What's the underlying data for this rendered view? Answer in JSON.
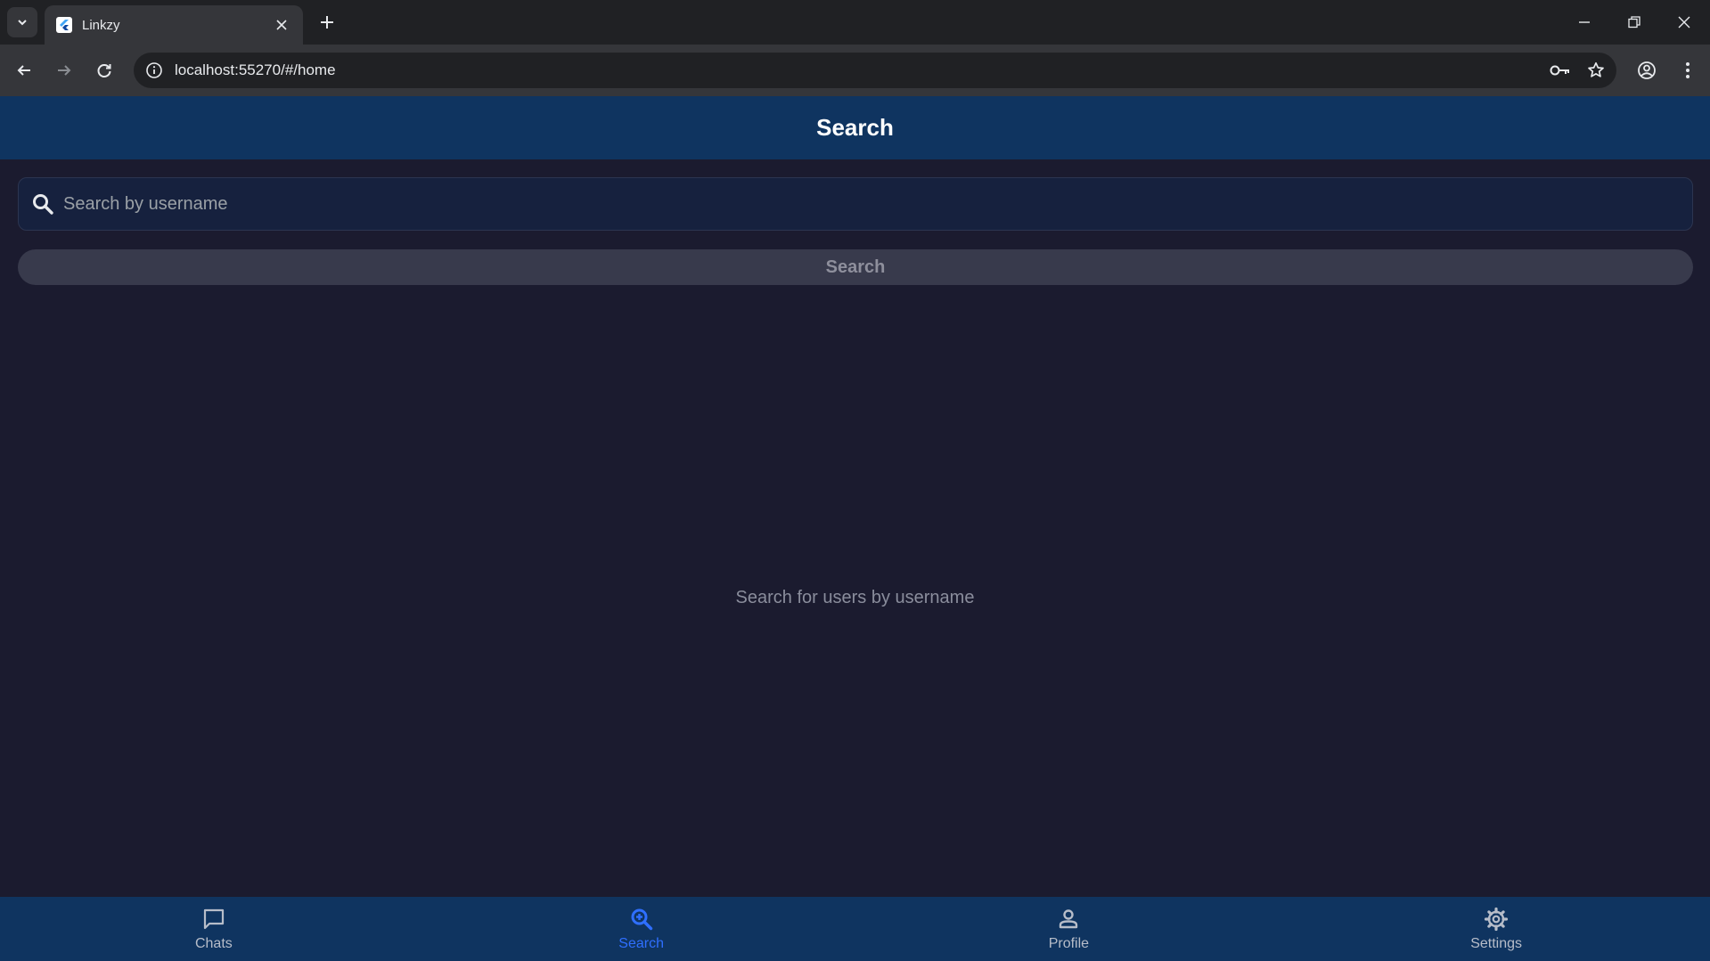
{
  "browser": {
    "tab_title": "Linkzy",
    "url": "localhost:55270/#/home"
  },
  "app": {
    "title": "Search",
    "search": {
      "placeholder": "Search by username",
      "value": "",
      "button_label": "Search"
    },
    "empty_message": "Search for users by username",
    "nav": {
      "items": [
        {
          "label": "Chats",
          "icon": "chat-bubble-icon"
        },
        {
          "label": "Search",
          "icon": "search-zoom-icon"
        },
        {
          "label": "Profile",
          "icon": "person-icon"
        },
        {
          "label": "Settings",
          "icon": "gear-icon"
        }
      ],
      "active": "Search"
    }
  },
  "colors": {
    "appbar": "#0f3460",
    "background": "#1b1b2f",
    "active_nav": "#2f6fff"
  }
}
